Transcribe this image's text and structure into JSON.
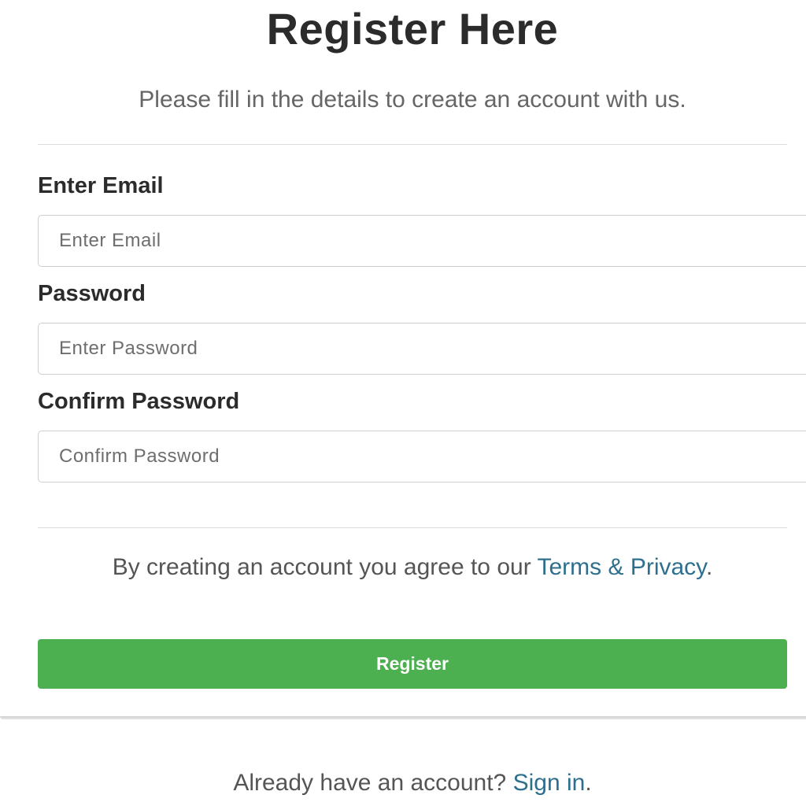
{
  "header": {
    "title": "Register Here",
    "subtitle": "Please fill in the details to create an account with us."
  },
  "form": {
    "email": {
      "label": "Enter Email",
      "placeholder": "Enter Email",
      "value": ""
    },
    "password": {
      "label": "Password",
      "placeholder": "Enter Password",
      "value": ""
    },
    "confirm_password": {
      "label": "Confirm Password",
      "placeholder": "Confirm Password",
      "value": ""
    }
  },
  "terms": {
    "text": "By creating an account you agree to our ",
    "link_label": "Terms & Privacy",
    "suffix": "."
  },
  "actions": {
    "register_label": "Register"
  },
  "footer": {
    "text": "Already have an account? ",
    "signin_label": "Sign in",
    "suffix": "."
  },
  "colors": {
    "primary_button": "#4caf50",
    "link": "#2e6f8e",
    "heading": "#2b2b2b",
    "muted_text": "#666666"
  }
}
